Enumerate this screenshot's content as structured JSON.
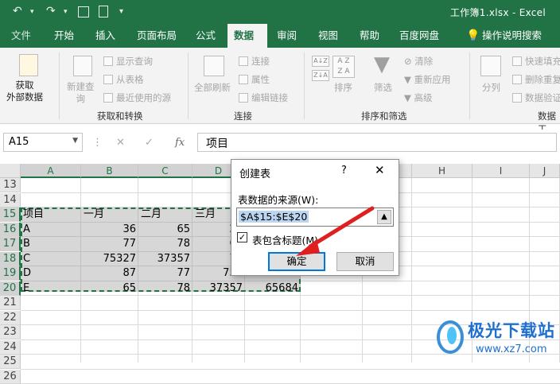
{
  "titlebar": {
    "title": "工作簿1.xlsx  -  Excel",
    "undo_icon": "undo-icon",
    "redo_icon": "redo-icon",
    "save_icon": "save-icon"
  },
  "tabs": [
    "文件",
    "开始",
    "插入",
    "页面布局",
    "公式",
    "数据",
    "审阅",
    "视图",
    "帮助",
    "百度网盘",
    "操作说明搜索"
  ],
  "active_tab": "数据",
  "ribbon": {
    "get_data": "获取\n外部数据",
    "new_query": "新建查\n询",
    "show_query": "显示查询",
    "from_table": "从表格",
    "recent_sources": "最近使用的源",
    "group_get": "获取和转换",
    "refresh_all": "全部刷新",
    "connections": "连接",
    "properties": "属性",
    "edit_links": "编辑链接",
    "group_conn": "连接",
    "sort": "排序",
    "filter": "筛选",
    "clear": "清除",
    "reapply": "重新应用",
    "advanced": "高级",
    "group_sort": "排序和筛选",
    "text_to_columns": "分列",
    "flash_fill": "快速填充",
    "remove_dup": "删除重复",
    "validation": "数据验证",
    "group_tools": "数据工"
  },
  "formula_bar": {
    "name_box": "A15",
    "content": "项目",
    "fx": "fx"
  },
  "columns": [
    "A",
    "B",
    "C",
    "D",
    "E",
    "F",
    "G",
    "H",
    "I",
    "J"
  ],
  "rows": [
    "13",
    "14",
    "15",
    "16",
    "17",
    "18",
    "19",
    "20",
    "21",
    "22",
    "23",
    "24",
    "25",
    "26"
  ],
  "table": [
    [
      "项目",
      "一月",
      "二月",
      "三月",
      ""
    ],
    [
      "A",
      "36",
      "65",
      "23",
      ""
    ],
    [
      "B",
      "77",
      "78",
      "60",
      ""
    ],
    [
      "C",
      "75327",
      "37357",
      "78",
      ""
    ],
    [
      "D",
      "87",
      "77",
      "753",
      ""
    ],
    [
      "E",
      "65",
      "78",
      "37357",
      "65684"
    ]
  ],
  "dialog": {
    "title": "创建表",
    "help": "?",
    "close": "✕",
    "source_label": "表数据的来源(W):",
    "source_value": "$A$15:$E$20",
    "has_headers_label": "表包含标题(M)",
    "has_headers": true,
    "ok": "确定",
    "cancel": "取消"
  },
  "watermark": {
    "name": "极光下载站",
    "url": "www.xz7.com"
  },
  "colors": {
    "brand": "#217346",
    "highlight": "#0078d7",
    "arrow": "#e02020"
  }
}
